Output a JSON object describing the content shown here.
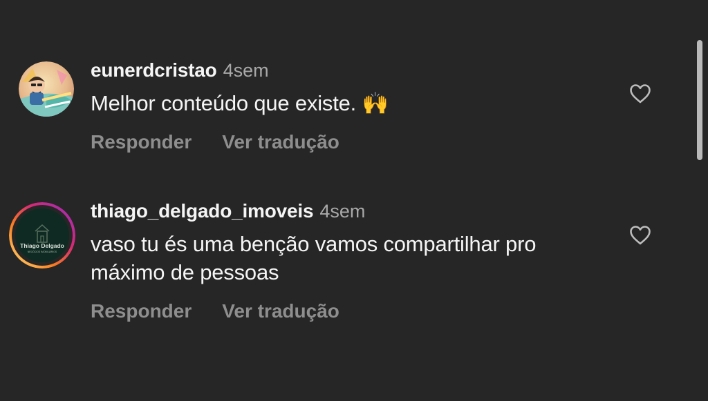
{
  "comments": [
    {
      "username": "eunerdcristao",
      "time": "4sem",
      "text": "Melhor conteúdo que existe. 🙌",
      "reply_label": "Responder",
      "translate_label": "Ver tradução",
      "avatar_icon": "profile-photo-cartoon-character",
      "like_icon": "heart-outline-icon"
    },
    {
      "username": "thiago_delgado_imoveis",
      "time": "4sem",
      "text": "vaso tu és uma benção vamos compartilhar pro máximo de pessoas",
      "reply_label": "Responder",
      "translate_label": "Ver tradução",
      "avatar_logo_text": "Thiago Delgado",
      "avatar_logo_subtext": "NEGÓCIOS IMOBILIÁRIOS",
      "avatar_icon": "house-logo",
      "like_icon": "heart-outline-icon"
    }
  ],
  "colors": {
    "background": "#262626",
    "primary_text": "#f5f5f5",
    "secondary_text": "#a8a8a8",
    "action_text": "#8e8e8e",
    "story_ring_start": "#feda75",
    "story_ring_mid": "#d62976",
    "story_ring_end": "#962fbf"
  }
}
